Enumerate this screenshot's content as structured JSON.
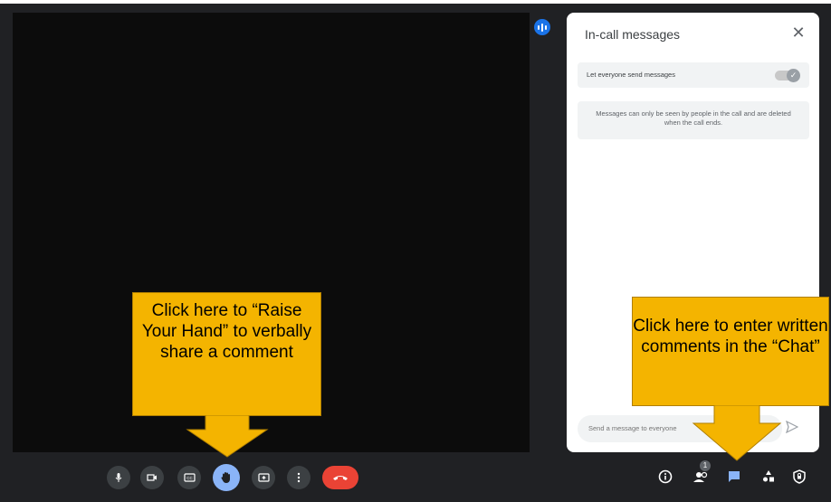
{
  "chat_panel": {
    "title": "In-call messages",
    "setting_label": "Let everyone send messages",
    "setting_enabled": true,
    "info_text": "Messages can only be seen by people in the call and are deleted when the call ends.",
    "input_placeholder": "Send a message to everyone"
  },
  "participants_badge": "1",
  "callouts": {
    "raise_hand": "Click here to “Raise Your Hand” to verbally share a comment",
    "chat": "Click here to enter written comments in the “Chat”"
  },
  "icons": {
    "controls": [
      "mic-icon",
      "camera-icon",
      "captions-icon",
      "raise-hand-icon",
      "present-icon",
      "more-options-icon",
      "end-call-icon"
    ],
    "right_controls": [
      "info-icon",
      "people-icon",
      "chat-icon",
      "activities-icon",
      "host-controls-icon"
    ]
  },
  "colors": {
    "accent": "#1a73e8",
    "hand_button": "#8ab4f8",
    "end_call": "#ea4335",
    "callout": "#f4b400"
  }
}
